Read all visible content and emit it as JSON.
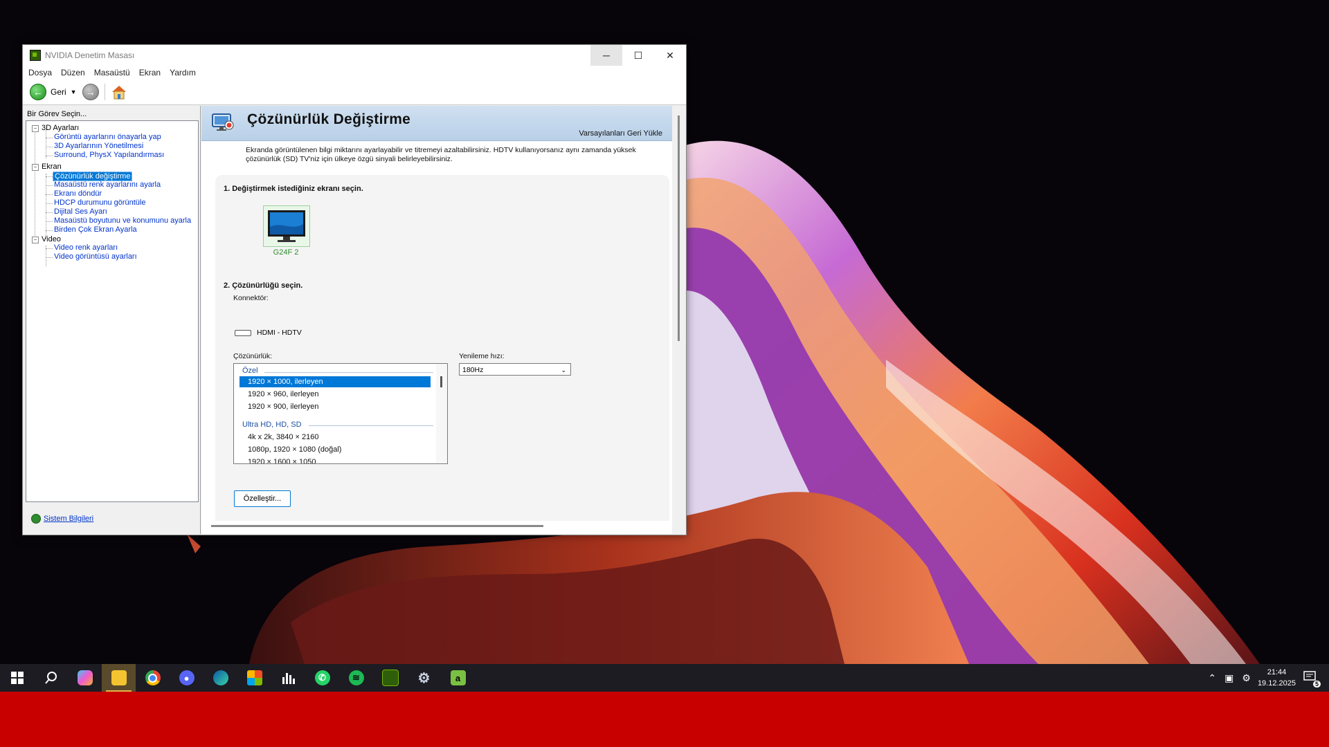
{
  "window": {
    "title": "NVIDIA Denetim Masası",
    "controls": {
      "minimize": "─",
      "maximize": "☐",
      "close": "✕"
    }
  },
  "menu": [
    "Dosya",
    "Düzen",
    "Masaüstü",
    "Ekran",
    "Yardım"
  ],
  "toolbar": {
    "back_label": "Geri"
  },
  "sidebar": {
    "task_label": "Bir Görev Seçin...",
    "tree": [
      {
        "label": "3D Ayarları",
        "type": "category"
      },
      {
        "label": "Görüntü ayarlarını önayarla yap",
        "type": "leaf"
      },
      {
        "label": "3D Ayarlarının Yönetilmesi",
        "type": "leaf"
      },
      {
        "label": "Surround, PhysX Yapılandırması",
        "type": "leaf"
      },
      {
        "label": "Ekran",
        "type": "category"
      },
      {
        "label": "Çözünürlük değiştirme",
        "type": "leaf",
        "selected": true
      },
      {
        "label": "Masaüstü renk ayarlarını ayarla",
        "type": "leaf"
      },
      {
        "label": "Ekranı döndür",
        "type": "leaf"
      },
      {
        "label": "HDCP durumunu görüntüle",
        "type": "leaf"
      },
      {
        "label": "Dijital Ses Ayarı",
        "type": "leaf"
      },
      {
        "label": "Masaüstü boyutunu ve konumunu ayarla",
        "type": "leaf"
      },
      {
        "label": "Birden Çok Ekran Ayarla",
        "type": "leaf"
      },
      {
        "label": "Video",
        "type": "category"
      },
      {
        "label": "Video renk ayarları",
        "type": "leaf"
      },
      {
        "label": "Video görüntüsü ayarları",
        "type": "leaf"
      }
    ],
    "sysinfo_link": "Sistem Bilgileri"
  },
  "content": {
    "title": "Çözünürlük Değiştirme",
    "restore_defaults": "Varsayılanları Geri Yükle",
    "description": "Ekranda görüntülenen bilgi miktarını ayarlayabilir ve titremeyi azaltabilirsiniz. HDTV kullanıyorsanız aynı zamanda yüksek çözünürlük (SD) TV'niz için ülkeye özgü sinyali belirleyebilirsiniz.",
    "step1": "1. Değiştirmek istediğiniz ekranı seçin.",
    "monitor_name": "G24F 2",
    "step2": "2. Çözünürlüğü seçin.",
    "connector_label": "Konnektör:",
    "connector_value": "HDMI - HDTV",
    "resolution_label": "Çözünürlük:",
    "refresh_label": "Yenileme hızı:",
    "refresh_value": "180Hz",
    "resolution_list": {
      "group1": "Özel",
      "group1_items": [
        "1920 × 1000, ilerleyen",
        "1920 × 960, ilerleyen",
        "1920 × 900, ilerleyen"
      ],
      "group2": "Ultra HD, HD, SD",
      "group2_items": [
        "4k x 2k, 3840 × 2160",
        "1080p, 1920 × 1080 (doğal)",
        "1920 × 1600 × 1050"
      ]
    },
    "customize_button": "Özelleştir..."
  },
  "taskbar": {
    "apps": [
      "start-icon",
      "search-icon",
      "copilot-icon",
      "file-explorer-icon",
      "chrome-icon",
      "discord-icon",
      "edge-icon",
      "store-icon",
      "audio-analyzer-icon",
      "whatsapp-icon",
      "spotify-icon",
      "nvidia-icon",
      "settings-icon",
      "app-a-icon"
    ],
    "time": "21:44",
    "date": "19.12.2025",
    "notification_count": "5"
  },
  "colors": {
    "accent": "#0078d7",
    "nvidia_green": "#76b900",
    "banner": "#c4d8ec",
    "redbar": "#c80000"
  }
}
